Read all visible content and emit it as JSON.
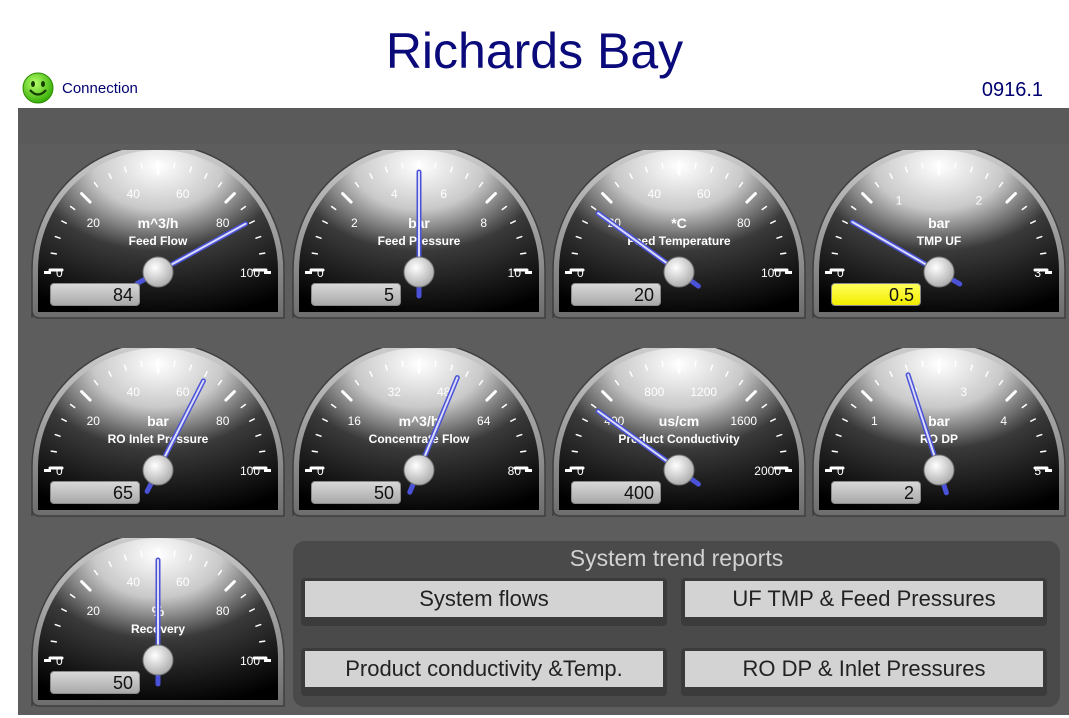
{
  "header": {
    "title": "Richards Bay",
    "connection_label": "Connection",
    "version": "0916.1"
  },
  "gauges": [
    {
      "unit": "m^3/h",
      "name": "Feed Flow",
      "min": "0",
      "max": "100",
      "labels": [
        "20",
        "40",
        "60",
        "80"
      ],
      "min_val": 0,
      "max_val": 100,
      "value": 84,
      "display": "84",
      "alarm": false
    },
    {
      "unit": "bar",
      "name": "Feed Pressure",
      "min": "0",
      "max": "10",
      "labels": [
        "2",
        "4",
        "6",
        "8"
      ],
      "min_val": 0,
      "max_val": 10,
      "value": 5,
      "display": "5",
      "alarm": false
    },
    {
      "unit": "*C",
      "name": "Feed Temperature",
      "min": "0",
      "max": "100",
      "labels": [
        "20",
        "40",
        "60",
        "80"
      ],
      "min_val": 0,
      "max_val": 100,
      "value": 20,
      "display": "20",
      "alarm": false
    },
    {
      "unit": "bar",
      "name": "TMP UF",
      "min": "0",
      "max": "3",
      "labels": [
        "1",
        "2"
      ],
      "min_val": 0,
      "max_val": 3,
      "value": 0.5,
      "display": "0.5",
      "alarm": true
    },
    {
      "unit": "bar",
      "name": "RO Inlet Pressure",
      "min": "0",
      "max": "100",
      "labels": [
        "20",
        "40",
        "60",
        "80"
      ],
      "min_val": 0,
      "max_val": 100,
      "value": 65,
      "display": "65",
      "alarm": false
    },
    {
      "unit": "m^3/h",
      "name": "Concentrate Flow",
      "min": "0",
      "max": "80",
      "labels": [
        "16",
        "32",
        "48",
        "64"
      ],
      "min_val": 0,
      "max_val": 80,
      "value": 50,
      "display": "50",
      "alarm": false
    },
    {
      "unit": "us/cm",
      "name": "Product Conductivity",
      "min": "0",
      "max": "2000",
      "labels": [
        "400",
        "800",
        "1200",
        "1600"
      ],
      "min_val": 0,
      "max_val": 2000,
      "value": 400,
      "display": "400",
      "alarm": false
    },
    {
      "unit": "bar",
      "name": "RO DP",
      "min": "0",
      "max": "5",
      "labels": [
        "1",
        "2",
        "3",
        "4"
      ],
      "min_val": 0,
      "max_val": 5,
      "value": 2,
      "display": "2",
      "alarm": false
    },
    {
      "unit": "%",
      "name": "Recovery",
      "min": "0",
      "max": "100",
      "labels": [
        "20",
        "40",
        "60",
        "80"
      ],
      "min_val": 0,
      "max_val": 100,
      "value": 50,
      "display": "50",
      "alarm": false
    }
  ],
  "trends": {
    "title": "System trend reports",
    "buttons": [
      "System flows",
      "UF TMP & Feed Pressures",
      "Product conductivity &Temp.",
      "RO DP & Inlet Pressures"
    ]
  },
  "colors": {
    "title": "#0a0a7a",
    "panel": "#5d5d5d",
    "needle": "#4a52d8",
    "alarm_value": "#ffff00",
    "connection_ok": "#4cd400"
  }
}
